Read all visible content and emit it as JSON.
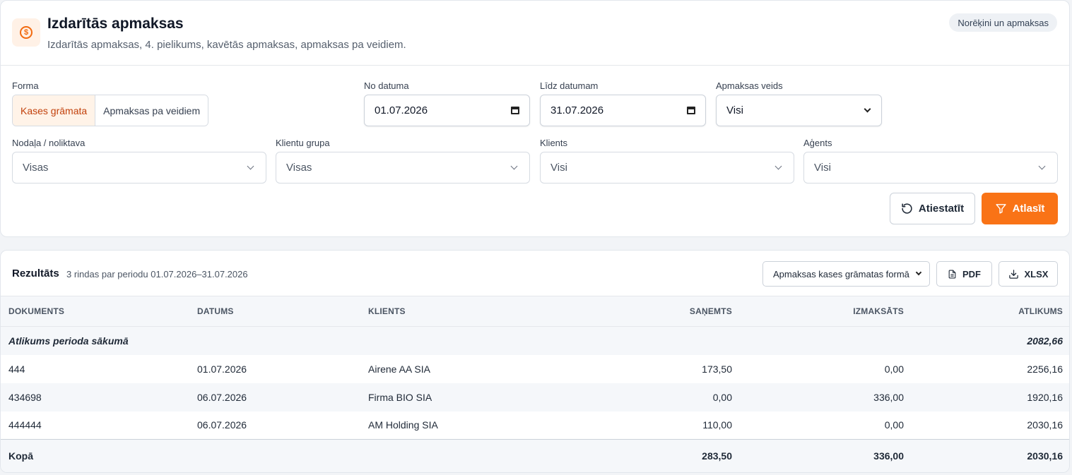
{
  "header": {
    "title": "Izdarītās apmaksas",
    "subtitle": "Izdarītās apmaksas, 4. pielikums, kavētās apmaksas, apmaksas pa veidiem.",
    "badge": "Norēķini un apmaksas",
    "icon": "coin-icon",
    "accent_color": "#f97316"
  },
  "filters": {
    "forma": {
      "label": "Forma",
      "options": [
        "Kases grāmata",
        "Apmaksas pa veidiem"
      ],
      "selected": "Kases grāmata"
    },
    "no_datuma": {
      "label": "No datuma",
      "value": "01.07.2026"
    },
    "lidz_datumam": {
      "label": "Līdz datumam",
      "value": "31.07.2026"
    },
    "apmaksas_veids": {
      "label": "Apmaksas veids",
      "value": "Visi"
    },
    "nodala": {
      "label": "Nodaļa / noliktava",
      "value": "Visas"
    },
    "klientu_grupa": {
      "label": "Klientu grupa",
      "value": "Visas"
    },
    "klients": {
      "label": "Klients",
      "value": "Visi"
    },
    "agents": {
      "label": "Aģents",
      "value": "Visi"
    },
    "reset_label": "Atiestatīt",
    "apply_label": "Atlasīt"
  },
  "results": {
    "title": "Rezultāts",
    "meta": "3 rindas par periodu 01.07.2026–31.07.2026",
    "form_select": "Apmaksas kases grāmatas formā",
    "pdf_label": "PDF",
    "xlsx_label": "XLSX",
    "columns": [
      "DOKUMENTS",
      "DATUMS",
      "KLIENTS",
      "SAŅEMTS",
      "IZMAKSĀTS",
      "ATLIKUMS"
    ],
    "opening": {
      "label": "Atlikums perioda sākumā",
      "balance": "2082,66"
    },
    "rows": [
      {
        "doc": "444",
        "date": "01.07.2026",
        "client": "Airene AA SIA",
        "received": "173,50",
        "paid": "0,00",
        "balance": "2256,16"
      },
      {
        "doc": "434698",
        "date": "06.07.2026",
        "client": "Firma BIO SIA",
        "received": "0,00",
        "paid": "336,00",
        "balance": "1920,16"
      },
      {
        "doc": "444444",
        "date": "06.07.2026",
        "client": "AM Holding SIA",
        "received": "110,00",
        "paid": "0,00",
        "balance": "2030,16"
      }
    ],
    "total": {
      "label": "Kopā",
      "received": "283,50",
      "paid": "336,00",
      "balance": "2030,16"
    }
  }
}
